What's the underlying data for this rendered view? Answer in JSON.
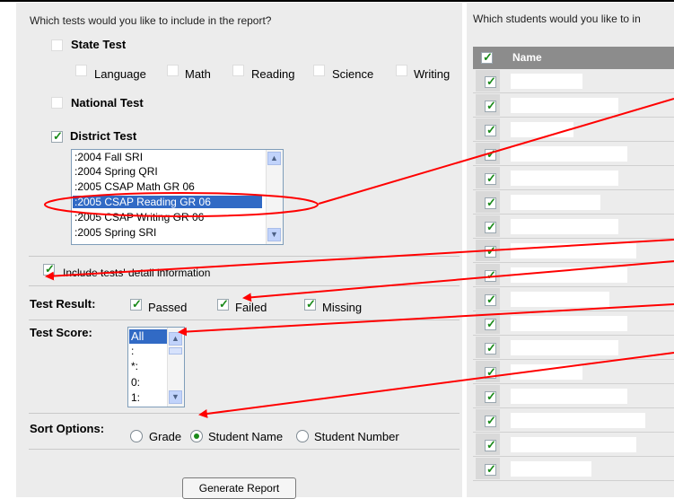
{
  "report": {
    "tests_question": "Which tests would you like to include in the report?",
    "students_question": "Which students would you like to in",
    "state_test": {
      "label": "State Test",
      "checked": false
    },
    "subjects": [
      {
        "label": "Language",
        "checked": false
      },
      {
        "label": "Math",
        "checked": false
      },
      {
        "label": "Reading",
        "checked": false
      },
      {
        "label": "Science",
        "checked": false
      },
      {
        "label": "Writing",
        "checked": false
      }
    ],
    "national_test": {
      "label": "National Test",
      "checked": false
    },
    "district_test": {
      "label": "District Test",
      "checked": true
    },
    "district_tests": [
      ":2004 Fall SRI",
      ":2004 Spring QRI",
      ":2005 CSAP Math GR 06",
      ":2005 CSAP Reading GR 06",
      ":2005 CSAP Writing GR 06",
      ":2005 Spring SRI"
    ],
    "district_selected_index": 3,
    "include_details": {
      "label": "Include tests' detail information",
      "checked": true
    },
    "test_result": {
      "label": "Test Result:",
      "options": [
        {
          "label": "Passed",
          "checked": true
        },
        {
          "label": "Failed",
          "checked": true
        },
        {
          "label": "Missing",
          "checked": true
        }
      ]
    },
    "test_score": {
      "label": "Test Score:",
      "options": [
        "All",
        ":",
        "*:",
        "0:",
        "1:"
      ],
      "selected_index": 0
    },
    "sort_options": {
      "label": "Sort Options:",
      "options": [
        "Grade",
        "Student Name",
        "Student Number"
      ],
      "selected_index": 1
    },
    "generate_button": "Generate Report"
  },
  "students_table": {
    "header_name": "Name",
    "header_checked": true,
    "row_count": 17
  },
  "colors": {
    "panel_bg": "#ececec",
    "header_bg": "#8c8c8c",
    "selection": "#316ac5",
    "check": "#1a8a1a",
    "annotation_red": "#ff0000"
  }
}
